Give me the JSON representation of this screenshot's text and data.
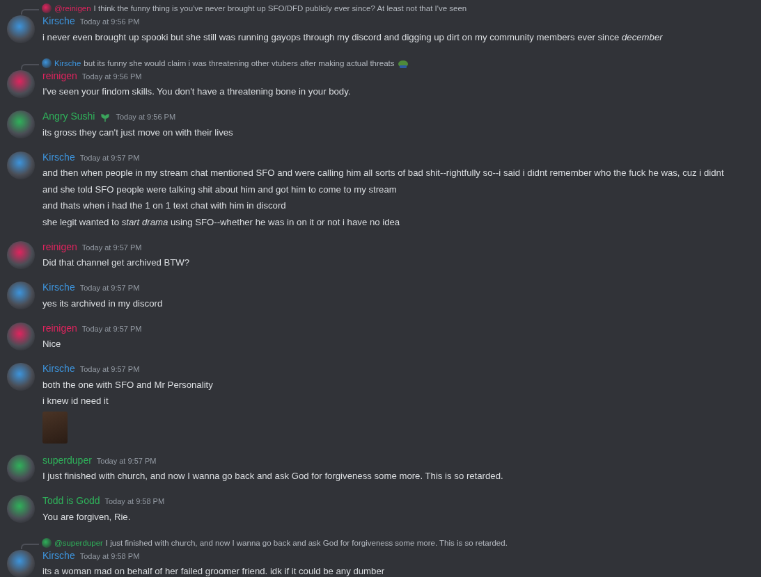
{
  "messages": [
    {
      "reply": {
        "author": "@reinigen",
        "color": "#e0245e",
        "text": "I think the funny thing is you've never brought up SFO/DFD publicly ever since? At least not that I've seen"
      },
      "author": "Kirsche",
      "color": "#3d94dc",
      "time": "Today at 9:56 PM",
      "lines": [
        "i never even brought up spooki but she still was running gayops through my discord and digging up dirt on my community members ever since *december*"
      ]
    },
    {
      "reply": {
        "author": "Kirsche",
        "color": "#3d94dc",
        "text": "but its funny she would claim i was threatening other vtubers after making actual threats",
        "emoji": true
      },
      "author": "reinigen",
      "color": "#e0245e",
      "time": "Today at 9:56 PM",
      "lines": [
        "I've seen your findom skills. You don't have a threatening bone in your body."
      ]
    },
    {
      "author": "Angry Sushi",
      "color": "#2fb15a",
      "badge": true,
      "time": "Today at 9:56 PM",
      "lines": [
        "its gross they can't just move on with their lives"
      ]
    },
    {
      "author": "Kirsche",
      "color": "#3d94dc",
      "time": "Today at 9:57 PM",
      "lines": [
        "and then when people in my stream chat mentioned SFO and were calling him all sorts of bad shit--rightfully so--i said i didnt remember who the fuck he was, cuz i didnt",
        "and she told SFO people were talking shit about him and got him to come to my stream",
        "and thats when i had the 1 on 1 text chat with him in discord",
        "she legit wanted to *start drama* using SFO--whether he was in on it or not i have no idea"
      ]
    },
    {
      "author": "reinigen",
      "color": "#e0245e",
      "time": "Today at 9:57 PM",
      "lines": [
        "Did that channel get archived BTW?"
      ]
    },
    {
      "author": "Kirsche",
      "color": "#3d94dc",
      "time": "Today at 9:57 PM",
      "lines": [
        "yes its archived in my discord"
      ]
    },
    {
      "author": "reinigen",
      "color": "#e0245e",
      "time": "Today at 9:57 PM",
      "lines": [
        "Nice"
      ]
    },
    {
      "author": "Kirsche",
      "color": "#3d94dc",
      "time": "Today at 9:57 PM",
      "lines": [
        "both the one with SFO and Mr Personality",
        "i knew id need it"
      ],
      "attachment": true
    },
    {
      "author": "superduper",
      "color": "#2fb15a",
      "time": "Today at 9:57 PM",
      "lines": [
        "I just finished with church, and now I wanna go back and ask God for forgiveness some more.  This is so retarded."
      ]
    },
    {
      "author": "Todd is Godd",
      "color": "#2fb15a",
      "time": "Today at 9:58 PM",
      "lines": [
        "You are forgiven, Rie."
      ]
    },
    {
      "reply": {
        "author": "@superduper",
        "color": "#2fb15a",
        "text": "I just finished with church, and now I wanna go back and ask God for forgiveness some more. This is so retarded."
      },
      "author": "Kirsche",
      "color": "#3d94dc",
      "time": "Today at 9:58 PM",
      "lines": [
        "its a woman mad on behalf of her failed groomer friend. idk if it could be any dumber"
      ]
    }
  ]
}
